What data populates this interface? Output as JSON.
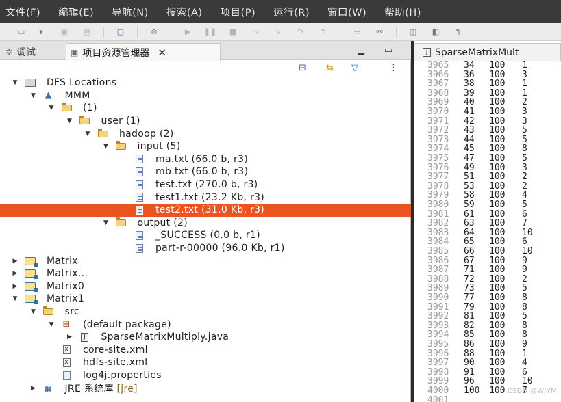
{
  "menu": [
    "文件(F)",
    "编辑(E)",
    "导航(N)",
    "搜索(A)",
    "项目(P)",
    "运行(R)",
    "窗口(W)",
    "帮助(H)"
  ],
  "panel": {
    "tab_inactive": "调试",
    "tab_active": "项目资源管理器",
    "close_glyph": "✕"
  },
  "tree": [
    {
      "label": "DFS Locations",
      "depth": 0,
      "arrow": "down",
      "icon": "dfs-icon"
    },
    {
      "label": "MMM",
      "depth": 1,
      "arrow": "down",
      "icon": "elephant-icon"
    },
    {
      "label": "(1)",
      "depth": 2,
      "arrow": "down",
      "icon": "folder-open-icon"
    },
    {
      "label": "user (1)",
      "depth": 3,
      "arrow": "down",
      "icon": "folder-open-icon"
    },
    {
      "label": "hadoop (2)",
      "depth": 4,
      "arrow": "down",
      "icon": "folder-open-icon"
    },
    {
      "label": "input (5)",
      "depth": 5,
      "arrow": "down",
      "icon": "folder-open-icon"
    },
    {
      "label": "ma.txt (66.0 b, r3)",
      "depth": 6,
      "arrow": "none",
      "icon": "file-icon"
    },
    {
      "label": "mb.txt (66.0 b, r3)",
      "depth": 6,
      "arrow": "none",
      "icon": "file-icon"
    },
    {
      "label": "test.txt (270.0 b, r3)",
      "depth": 6,
      "arrow": "none",
      "icon": "file-icon"
    },
    {
      "label": "test1.txt (23.2 Kb, r3)",
      "depth": 6,
      "arrow": "none",
      "icon": "file-icon"
    },
    {
      "label": "test2.txt (31.0 Kb, r3)",
      "depth": 6,
      "arrow": "none",
      "icon": "file-icon",
      "selected": true
    },
    {
      "label": "output (2)",
      "depth": 5,
      "arrow": "down",
      "icon": "folder-open-icon"
    },
    {
      "label": "_SUCCESS (0.0 b, r1)",
      "depth": 6,
      "arrow": "none",
      "icon": "file-icon"
    },
    {
      "label": "part-r-00000 (96.0 Kb, r1)",
      "depth": 6,
      "arrow": "none",
      "icon": "file-icon"
    },
    {
      "label": "Matrix",
      "depth": 0,
      "arrow": "right",
      "icon": "project-icon"
    },
    {
      "label": "Matrix...",
      "depth": 0,
      "arrow": "right",
      "icon": "project-icon"
    },
    {
      "label": "Matrix0",
      "depth": 0,
      "arrow": "right",
      "icon": "project-icon"
    },
    {
      "label": "Matrix1",
      "depth": 0,
      "arrow": "down",
      "icon": "project-icon"
    },
    {
      "label": "src",
      "depth": 1,
      "arrow": "down",
      "icon": "source-folder-icon"
    },
    {
      "label": "(default package)",
      "depth": 2,
      "arrow": "down",
      "icon": "package-icon"
    },
    {
      "label": "SparseMatrixMultiply.java",
      "depth": 3,
      "arrow": "right",
      "icon": "java-file-icon"
    },
    {
      "label": "core-site.xml",
      "depth": 2,
      "arrow": "none",
      "icon": "xml-file-icon"
    },
    {
      "label": "hdfs-site.xml",
      "depth": 2,
      "arrow": "none",
      "icon": "xml-file-icon"
    },
    {
      "label": "log4j.properties",
      "depth": 2,
      "arrow": "none",
      "icon": "properties-file-icon"
    },
    {
      "label": "JRE 系统库",
      "suffix": "[jre]",
      "depth": 1,
      "arrow": "right",
      "icon": "jre-library-icon"
    }
  ],
  "editor": {
    "tab_title": "SparseMatrixMult",
    "lines": [
      {
        "n": "3965",
        "a": "34",
        "b": "100",
        "c": "1"
      },
      {
        "n": "3966",
        "a": "36",
        "b": "100",
        "c": "3"
      },
      {
        "n": "3967",
        "a": "38",
        "b": "100",
        "c": "1"
      },
      {
        "n": "3968",
        "a": "39",
        "b": "100",
        "c": "1"
      },
      {
        "n": "3969",
        "a": "40",
        "b": "100",
        "c": "2"
      },
      {
        "n": "3970",
        "a": "41",
        "b": "100",
        "c": "3"
      },
      {
        "n": "3971",
        "a": "42",
        "b": "100",
        "c": "3"
      },
      {
        "n": "3972",
        "a": "43",
        "b": "100",
        "c": "5"
      },
      {
        "n": "3973",
        "a": "44",
        "b": "100",
        "c": "5"
      },
      {
        "n": "3974",
        "a": "45",
        "b": "100",
        "c": "8"
      },
      {
        "n": "3975",
        "a": "47",
        "b": "100",
        "c": "5"
      },
      {
        "n": "3976",
        "a": "49",
        "b": "100",
        "c": "3"
      },
      {
        "n": "3977",
        "a": "51",
        "b": "100",
        "c": "2"
      },
      {
        "n": "3978",
        "a": "53",
        "b": "100",
        "c": "2"
      },
      {
        "n": "3979",
        "a": "58",
        "b": "100",
        "c": "4"
      },
      {
        "n": "3980",
        "a": "59",
        "b": "100",
        "c": "5"
      },
      {
        "n": "3981",
        "a": "61",
        "b": "100",
        "c": "6"
      },
      {
        "n": "3982",
        "a": "63",
        "b": "100",
        "c": "7"
      },
      {
        "n": "3983",
        "a": "64",
        "b": "100",
        "c": "10"
      },
      {
        "n": "3984",
        "a": "65",
        "b": "100",
        "c": "6"
      },
      {
        "n": "3985",
        "a": "66",
        "b": "100",
        "c": "10"
      },
      {
        "n": "3986",
        "a": "67",
        "b": "100",
        "c": "9"
      },
      {
        "n": "3987",
        "a": "71",
        "b": "100",
        "c": "9"
      },
      {
        "n": "3988",
        "a": "72",
        "b": "100",
        "c": "2"
      },
      {
        "n": "3989",
        "a": "73",
        "b": "100",
        "c": "5"
      },
      {
        "n": "3990",
        "a": "77",
        "b": "100",
        "c": "8"
      },
      {
        "n": "3991",
        "a": "79",
        "b": "100",
        "c": "8"
      },
      {
        "n": "3992",
        "a": "81",
        "b": "100",
        "c": "5"
      },
      {
        "n": "3993",
        "a": "82",
        "b": "100",
        "c": "8"
      },
      {
        "n": "3994",
        "a": "85",
        "b": "100",
        "c": "8"
      },
      {
        "n": "3995",
        "a": "86",
        "b": "100",
        "c": "9"
      },
      {
        "n": "3996",
        "a": "88",
        "b": "100",
        "c": "1"
      },
      {
        "n": "3997",
        "a": "90",
        "b": "100",
        "c": "4"
      },
      {
        "n": "3998",
        "a": "91",
        "b": "100",
        "c": "6"
      },
      {
        "n": "3999",
        "a": "96",
        "b": "100",
        "c": "10"
      },
      {
        "n": "4000",
        "a": "100",
        "b": "100",
        "c": "7"
      },
      {
        "n": "4001",
        "a": "",
        "b": "",
        "c": ""
      }
    ]
  },
  "watermark": "CSDN @WJYM",
  "colors": {
    "selection": "#e95420",
    "menubar": "#3a3a38"
  }
}
